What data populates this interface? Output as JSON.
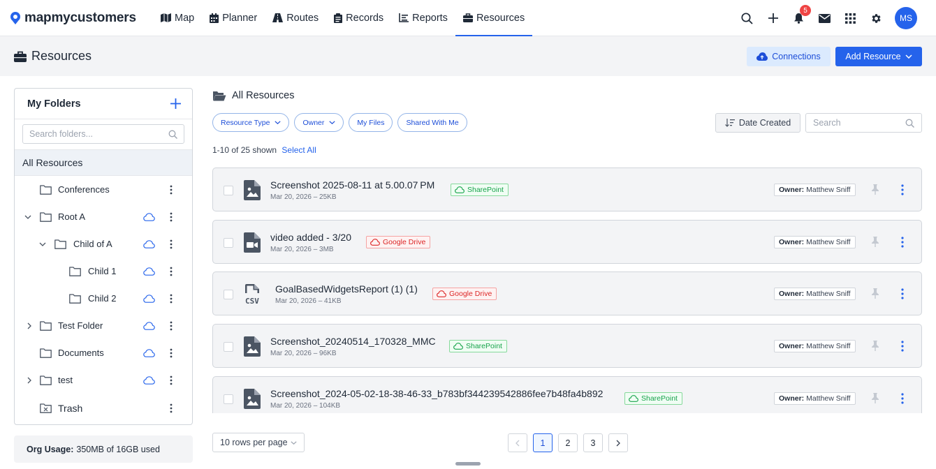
{
  "nav": {
    "brand": "mapmycustomers",
    "items": [
      {
        "label": "Map",
        "icon": "map-icon"
      },
      {
        "label": "Planner",
        "icon": "calendar-icon"
      },
      {
        "label": "Routes",
        "icon": "routes-icon"
      },
      {
        "label": "Records",
        "icon": "records-icon"
      },
      {
        "label": "Reports",
        "icon": "reports-icon"
      },
      {
        "label": "Resources",
        "icon": "briefcase-icon"
      }
    ],
    "active": "Resources",
    "notification_count": "5",
    "avatar_initials": "MS",
    "accent": "#2563eb"
  },
  "header": {
    "title": "Resources",
    "connections_label": "Connections",
    "add_label": "Add Resource"
  },
  "sidebar": {
    "title": "My Folders",
    "search_placeholder": "Search folders...",
    "all_label": "All Resources",
    "folders": [
      {
        "label": "Conferences"
      },
      {
        "label": "Root A"
      },
      {
        "label": "Child of A"
      },
      {
        "label": "Child 1"
      },
      {
        "label": "Child 2"
      },
      {
        "label": "Test Folder"
      },
      {
        "label": "Documents"
      },
      {
        "label": "test"
      },
      {
        "label": "Trash"
      }
    ],
    "usage_label": "Org Usage:",
    "usage_value": "350MB of 16GB used"
  },
  "main": {
    "title": "All Resources",
    "filters": [
      "Resource Type",
      "Owner",
      "My Files",
      "Shared With Me"
    ],
    "sort_label": "Date Created",
    "search_placeholder": "Search",
    "count_text": "1-10 of 25 shown",
    "select_all": "Select All",
    "owner_label": "Owner:",
    "files": [
      {
        "name": "Screenshot 2025-08-11 at 5.00.07 PM",
        "meta": "Mar 20, 2026 – 25KB",
        "source": "SharePoint",
        "owner": "Matthew Sniff",
        "type": "image"
      },
      {
        "name": "video added - 3/20",
        "meta": "Mar 20, 2026 – 3MB",
        "source": "Google Drive",
        "owner": "Matthew Sniff",
        "type": "video"
      },
      {
        "name": "GoalBasedWidgetsReport (1) (1)",
        "meta": "Mar 20, 2026 – 41KB",
        "source": "Google Drive",
        "owner": "Matthew Sniff",
        "type": "csv"
      },
      {
        "name": "Screenshot_20240514_170328_MMC",
        "meta": "Mar 20, 2026 – 96KB",
        "source": "SharePoint",
        "owner": "Matthew Sniff",
        "type": "image"
      },
      {
        "name": "Screenshot_2024-05-02-18-38-46-33_b783bf344239542886fee7b48fa4b892",
        "meta": "Mar 20, 2026 – 104KB",
        "source": "SharePoint",
        "owner": "Matthew Sniff",
        "type": "image"
      }
    ],
    "csv_badge": "CSV"
  },
  "footer": {
    "rows_per_page": "10 rows per page",
    "pages": [
      "1",
      "2",
      "3"
    ],
    "current_page": "1"
  },
  "colors": {
    "sharepoint": "#16a34a",
    "google_drive": "#dc2626",
    "primary": "#2563eb"
  }
}
